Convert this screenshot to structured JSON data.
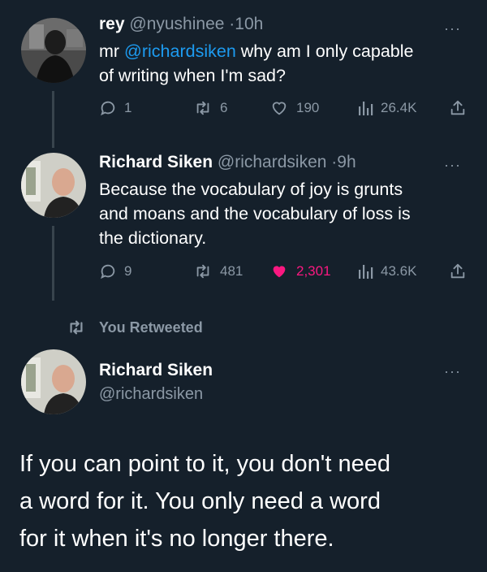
{
  "tweets": [
    {
      "display_name": "rey",
      "handle": "@nyushinee",
      "separator": "·",
      "time": "10h",
      "text_prefix": "mr ",
      "mention": "@richardsiken",
      "text_line1_rest": " why am I only capable",
      "text_line2": "of writing when I'm sad?",
      "more": "···",
      "stats": {
        "replies": "1",
        "retweets": "6",
        "likes": "190",
        "views": "26.4K"
      }
    },
    {
      "display_name": "Richard Siken",
      "handle": "@richardsiken",
      "separator": "·",
      "time": "9h",
      "text_line1": "Because the vocabulary of joy is grunts",
      "text_line2": "and moans and the vocabulary of loss is",
      "text_line3": "the dictionary.",
      "more": "···",
      "stats": {
        "replies": "9",
        "retweets": "481",
        "likes": "2,301",
        "views": "43.6K"
      }
    }
  ],
  "retweet_banner": {
    "label": "You Retweeted"
  },
  "main_tweet": {
    "display_name": "Richard Siken",
    "handle": "@richardsiken",
    "more": "···",
    "text_line1": "If you can point to it, you don't need",
    "text_line2": "a word for it. You only need a word",
    "text_line3": "for it when it's no longer there."
  },
  "colors": {
    "background": "#15202b",
    "muted": "#8b98a5",
    "accent": "#1d9bf0",
    "like": "#f91880",
    "thread_line": "#38444d"
  }
}
